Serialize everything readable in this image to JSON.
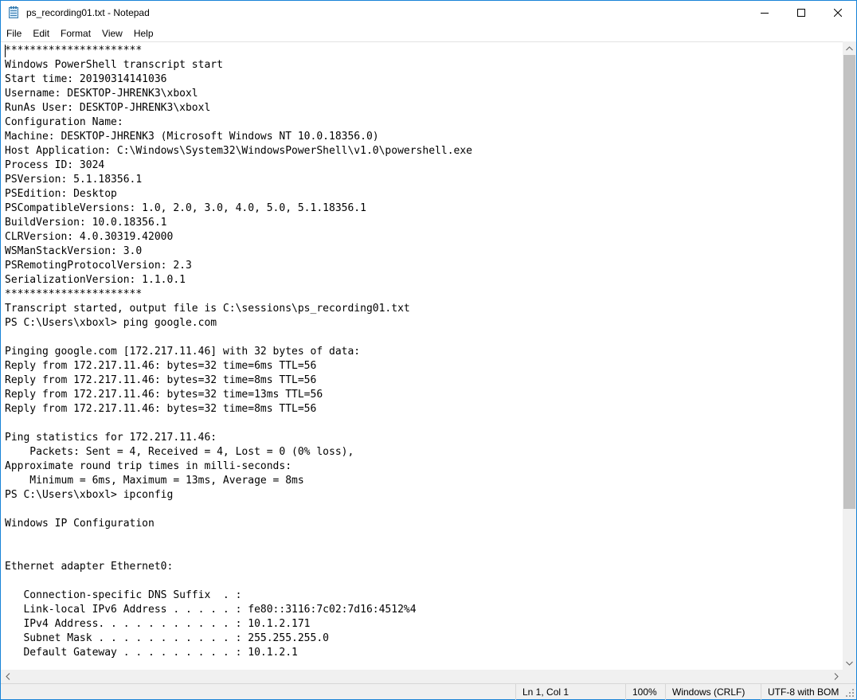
{
  "window": {
    "title": "ps_recording01.txt - Notepad",
    "accent_color": "#1883d7",
    "app_icon": "notepad-icon",
    "caption_buttons": [
      "minimize-icon",
      "maximize-icon",
      "close-icon"
    ]
  },
  "menu": {
    "items": [
      "File",
      "Edit",
      "Format",
      "View",
      "Help"
    ]
  },
  "editor": {
    "lines": [
      "**********************",
      "Windows PowerShell transcript start",
      "Start time: 20190314141036",
      "Username: DESKTOP-JHRENK3\\xboxl",
      "RunAs User: DESKTOP-JHRENK3\\xboxl",
      "Configuration Name:",
      "Machine: DESKTOP-JHRENK3 (Microsoft Windows NT 10.0.18356.0)",
      "Host Application: C:\\Windows\\System32\\WindowsPowerShell\\v1.0\\powershell.exe",
      "Process ID: 3024",
      "PSVersion: 5.1.18356.1",
      "PSEdition: Desktop",
      "PSCompatibleVersions: 1.0, 2.0, 3.0, 4.0, 5.0, 5.1.18356.1",
      "BuildVersion: 10.0.18356.1",
      "CLRVersion: 4.0.30319.42000",
      "WSManStackVersion: 3.0",
      "PSRemotingProtocolVersion: 2.3",
      "SerializationVersion: 1.1.0.1",
      "**********************",
      "Transcript started, output file is C:\\sessions\\ps_recording01.txt",
      "PS C:\\Users\\xboxl> ping google.com",
      "",
      "Pinging google.com [172.217.11.46] with 32 bytes of data:",
      "Reply from 172.217.11.46: bytes=32 time=6ms TTL=56",
      "Reply from 172.217.11.46: bytes=32 time=8ms TTL=56",
      "Reply from 172.217.11.46: bytes=32 time=13ms TTL=56",
      "Reply from 172.217.11.46: bytes=32 time=8ms TTL=56",
      "",
      "Ping statistics for 172.217.11.46:",
      "    Packets: Sent = 4, Received = 4, Lost = 0 (0% loss),",
      "Approximate round trip times in milli-seconds:",
      "    Minimum = 6ms, Maximum = 13ms, Average = 8ms",
      "PS C:\\Users\\xboxl> ipconfig",
      "",
      "Windows IP Configuration",
      "",
      "",
      "Ethernet adapter Ethernet0:",
      "",
      "   Connection-specific DNS Suffix  . :",
      "   Link-local IPv6 Address . . . . . : fe80::3116:7c02:7d16:4512%4",
      "   IPv4 Address. . . . . . . . . . . : 10.1.2.171",
      "   Subnet Mask . . . . . . . . . . . : 255.255.255.0",
      "   Default Gateway . . . . . . . . . : 10.1.2.1"
    ]
  },
  "statusbar": {
    "position": "Ln 1, Col 1",
    "zoom": "100%",
    "line_ending": "Windows (CRLF)",
    "encoding": "UTF-8 with BOM"
  }
}
